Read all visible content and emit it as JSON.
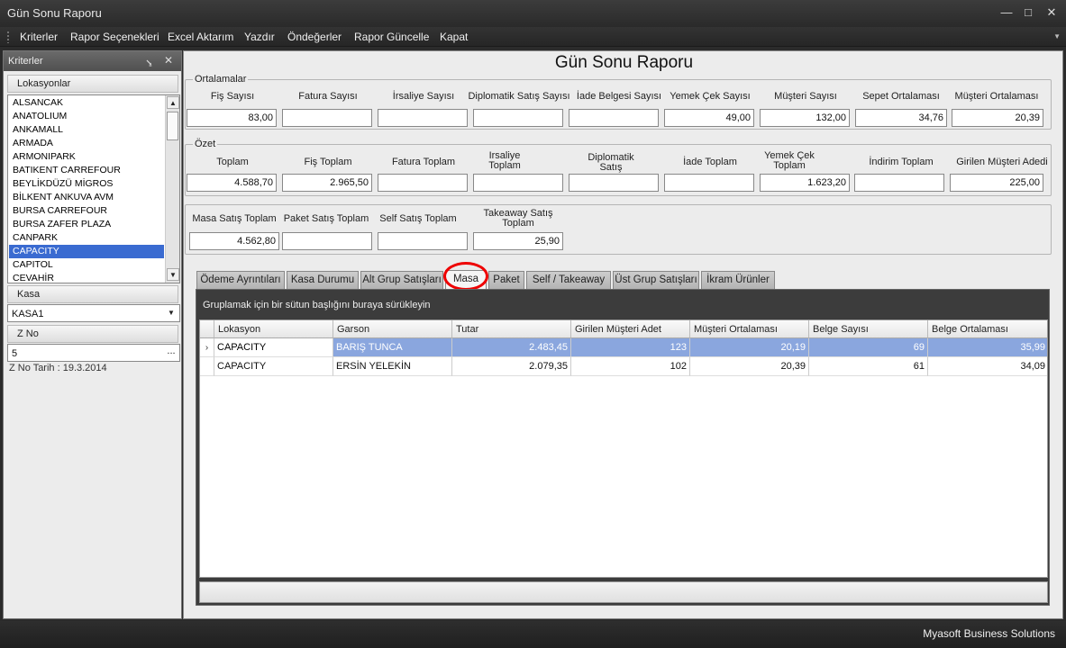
{
  "window": {
    "title": "Gün Sonu Raporu"
  },
  "menu": [
    "Kriterler",
    "Rapor Seçenekleri",
    "Excel Aktarım",
    "Yazdır",
    "Öndeğerler",
    "Rapor Güncelle",
    "Kapat"
  ],
  "left_panel": {
    "title": "Kriterler",
    "lokasyon_header": "Lokasyonlar",
    "locations": [
      "ALSANCAK",
      "ANATOLIUM",
      "ANKAMALL",
      "ARMADA",
      "ARMONIPARK",
      "BATIKENT CARREFOUR",
      "BEYLİKDÜZÜ MİGROS",
      "BİLKENT ANKUVA AVM",
      "BURSA CARREFOUR",
      "BURSA ZAFER PLAZA",
      "CANPARK",
      "CAPACITY",
      "CAPITOL",
      "CEVAHİR"
    ],
    "selected_location": "CAPACITY",
    "kasa_header": "Kasa",
    "kasa_value": "KASA1",
    "zno_header": "Z No",
    "zno_value": "5",
    "zno_button": "...",
    "zno_date": "Z No Tarih : 19.3.2014"
  },
  "report": {
    "title": "Gün Sonu Raporu",
    "ortalamalar": {
      "legend": "Ortalamalar",
      "labels": [
        "Fiş Sayısı",
        "Fatura Sayısı",
        "İrsaliye Sayısı",
        "Diplomatik Satış Sayısı",
        "İade Belgesi Sayısı",
        "Yemek Çek Sayısı",
        "Müşteri Sayısı",
        "Sepet Ortalaması",
        "Müşteri Ortalaması"
      ],
      "values": [
        "83,00",
        "",
        "",
        "",
        "",
        "49,00",
        "132,00",
        "34,76",
        "20,39"
      ]
    },
    "ozet": {
      "legend": "Özet",
      "labels": [
        "Toplam",
        "Fiş Toplam",
        "Fatura Toplam",
        "Irsaliye Toplam",
        "Diplomatik Satış",
        "İade Toplam",
        "Yemek Çek Toplam",
        "İndirim Toplam",
        "Girilen Müşteri Adedi"
      ],
      "values": [
        "4.588,70",
        "2.965,50",
        "",
        "",
        "",
        "",
        "1.623,20",
        "",
        "225,00"
      ]
    },
    "satis": {
      "labels": [
        "Masa Satış Toplam",
        "Paket Satış Toplam",
        "Self Satış Toplam",
        "Takeaway Satış Toplam"
      ],
      "values": [
        "4.562,80",
        "",
        "",
        "25,90"
      ]
    }
  },
  "tabs": [
    "Ödeme Ayrıntıları",
    "Kasa Durumu",
    "Alt Grup Satışları",
    "Masa",
    "Paket",
    "Self / Takeaway",
    "Üst Grup Satışları",
    "İkram Ürünler"
  ],
  "active_tab": "Masa",
  "grid": {
    "group_hint": "Gruplamak için bir sütun başlığını buraya sürükleyin",
    "columns": [
      "Lokasyon",
      "Garson",
      "Tutar",
      "Girilen Müşteri Adet",
      "Müşteri Ortalaması",
      "Belge Sayısı",
      "Belge Ortalaması"
    ],
    "rows": [
      [
        "CAPACITY",
        "BARIŞ TUNCA",
        "2.483,45",
        "123",
        "20,19",
        "69",
        "35,99"
      ],
      [
        "CAPACITY",
        "ERSİN YELEKİN",
        "2.079,35",
        "102",
        "20,39",
        "61",
        "34,09"
      ]
    ],
    "selected_row_indicator": "›"
  },
  "status": {
    "company": "Myasoft Business Solutions"
  },
  "colors": {
    "selection": "#3a6bd1",
    "row_selection": "#8aa6de",
    "highlight_circle": "#e00000"
  }
}
